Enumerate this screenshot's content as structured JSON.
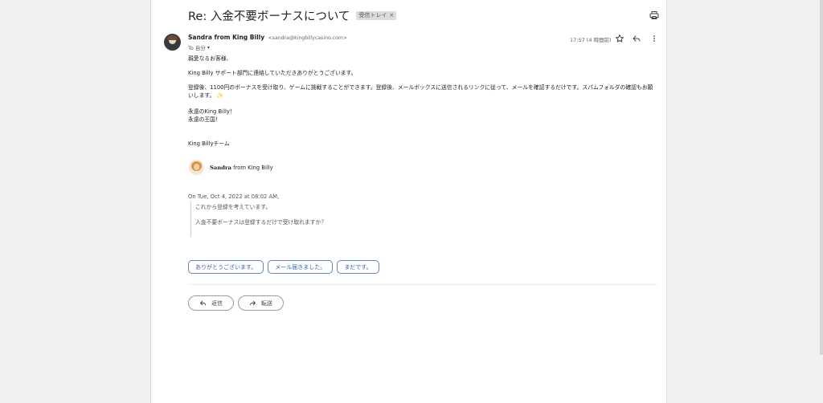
{
  "email": {
    "subject": "Re: 入金不要ボーナスについて",
    "label": "受信トレイ",
    "label_close": "×",
    "sender_name": "Sandra from King Billy",
    "sender_email": "<sandra@kingbillycasino.com>",
    "recipient": "To 自分",
    "time": "17:57 (4 時間前)",
    "body": {
      "greeting": "親愛なるお客様、",
      "thanks": "King Billy サポート部門に連絡していただきありがとうございます。",
      "info": "登録後、1100円のボーナスを受け取り、ゲームに挑戦することができます。登録後、メールボックスに送信されるリンクに従って、メールを確認するだけです。スパムフォルダの確認もお願いします。",
      "sparkle": "✨",
      "sig_line1": "永遠のKing Billy！",
      "sig_line2": "永遠の王国！",
      "team": "King Billyチーム"
    },
    "signature": {
      "name": "Sandra",
      "suffix": "from King Billy"
    },
    "quote": {
      "header": "On Tue, Oct 4, 2022 at 08:02 AM,",
      "line1": "これから登録を考えています。",
      "line2": "入金不要ボーナスは登録するだけで受け取れますか？"
    }
  },
  "smart_replies": [
    "ありがとうございます。",
    "メール届きました。",
    "まだです。"
  ],
  "actions": {
    "reply": "返信",
    "forward": "転送"
  },
  "icons": [
    "print-icon",
    "star-icon",
    "reply-icon",
    "more-vert-icon",
    "forward-icon"
  ]
}
